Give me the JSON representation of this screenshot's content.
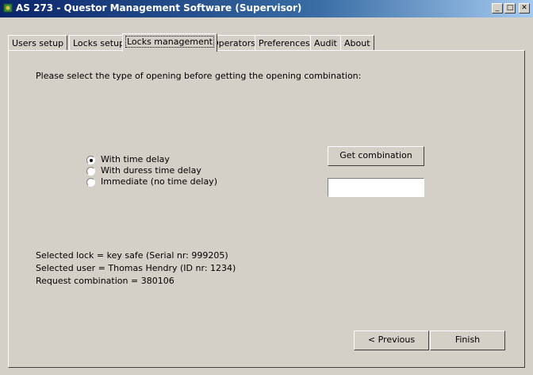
{
  "window": {
    "title": "AS 273 - Questor Management Software (Supervisor)",
    "controls": {
      "minimize": "_",
      "maximize": "□",
      "close": "✕"
    }
  },
  "tabs": [
    {
      "label": "Users setup",
      "active": false
    },
    {
      "label": "Locks setup",
      "active": false
    },
    {
      "label": "Locks management",
      "active": true
    },
    {
      "label": "Operators",
      "active": false
    },
    {
      "label": "Preferences",
      "active": false
    },
    {
      "label": "Audit",
      "active": false
    },
    {
      "label": "About",
      "active": false
    }
  ],
  "main": {
    "instruction": "Please select the type of opening before getting the opening combination:",
    "opening_types": [
      {
        "label": "With time delay",
        "selected": true
      },
      {
        "label": "With duress time delay",
        "selected": false
      },
      {
        "label": "Immediate (no time delay)",
        "selected": false
      }
    ],
    "get_combination_label": "Get combination",
    "combination_value": "",
    "info": {
      "selected_lock": "Selected lock = key safe (Serial nr: 999205)",
      "selected_user": "Selected user = Thomas Hendry (ID nr: 1234)",
      "request_combination": "Request combination = 380106"
    },
    "previous_label": "< Previous",
    "finish_label": "Finish"
  }
}
